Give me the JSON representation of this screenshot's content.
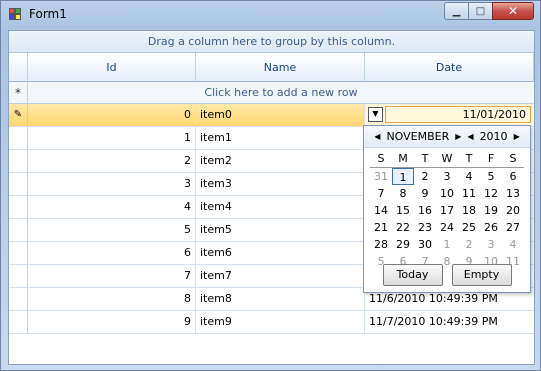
{
  "window": {
    "title": "Form1"
  },
  "grid": {
    "group_panel": "Drag a column here to group by this column.",
    "columns": [
      "Id",
      "Name",
      "Date"
    ],
    "new_row_text": "Click here to add a new row",
    "rows": [
      {
        "id": "0",
        "name": "item0",
        "date": "11/01/2010"
      },
      {
        "id": "1",
        "name": "item1",
        "date": ""
      },
      {
        "id": "2",
        "name": "item2",
        "date": ""
      },
      {
        "id": "3",
        "name": "item3",
        "date": ""
      },
      {
        "id": "4",
        "name": "item4",
        "date": ""
      },
      {
        "id": "5",
        "name": "item5",
        "date": ""
      },
      {
        "id": "6",
        "name": "item6",
        "date": ""
      },
      {
        "id": "7",
        "name": "item7",
        "date": ""
      },
      {
        "id": "8",
        "name": "item8",
        "date": "11/6/2010 10:49:39 PM"
      },
      {
        "id": "9",
        "name": "item9",
        "date": "11/7/2010 10:49:39 PM"
      }
    ]
  },
  "calendar": {
    "month": "NOVEMBER",
    "year": "2010",
    "weekdays": [
      "S",
      "M",
      "T",
      "W",
      "T",
      "F",
      "S"
    ],
    "days": [
      "31",
      "1",
      "2",
      "3",
      "4",
      "5",
      "6",
      "7",
      "8",
      "9",
      "10",
      "11",
      "12",
      "13",
      "14",
      "15",
      "16",
      "17",
      "18",
      "19",
      "20",
      "21",
      "22",
      "23",
      "24",
      "25",
      "26",
      "27",
      "28",
      "29",
      "30",
      "1",
      "2",
      "3",
      "4",
      "5",
      "6",
      "7",
      "8",
      "9",
      "10",
      "11"
    ],
    "today_label": "Today",
    "empty_label": "Empty"
  },
  "icons": {
    "app": "form-icon",
    "minimize": "minimize-icon",
    "maximize": "maximize-icon",
    "close": "close-icon",
    "new_row": "asterisk-icon",
    "edit": "pencil-icon",
    "dropdown": "dropdown-arrow-icon"
  }
}
